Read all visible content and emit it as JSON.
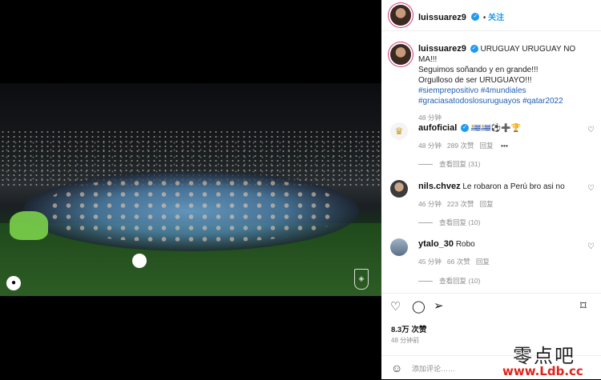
{
  "post": {
    "username": "luissuarez9",
    "follow_label": "关注",
    "caption_line1": "URUGUAY URUGUAY NO MA!!!",
    "caption_line2": "Seguimos soñando y en grande!!!",
    "caption_line3": "Orgulloso de ser URUGUAYO!!!",
    "hashtags_line1": "#siemprepositivo #4mundiales",
    "hashtags_line2": "#graciasatodoslosuruguayos #qatar2022",
    "caption_time": "48 分钟"
  },
  "comments": [
    {
      "user": "aufoficial",
      "verified": true,
      "text": "🇺🇾🇺🇾⚽➕🏆",
      "time": "48 分钟",
      "likes": "289 次赞",
      "reply": "回复",
      "more": "•••",
      "view_replies": "查看回复 (31)"
    },
    {
      "user": "nils.chvez",
      "verified": false,
      "text": "Le robaron a Perú bro asi no",
      "time": "46 分钟",
      "likes": "223 次赞",
      "reply": "回复",
      "view_replies": "查看回复 (10)"
    },
    {
      "user": "ytalo_30",
      "verified": false,
      "text": "Robo",
      "time": "45 分钟",
      "likes": "66 次赞",
      "reply": "回复",
      "view_replies": "查看回复 (10)"
    }
  ],
  "footer": {
    "likes": "8.3万 次赞",
    "posted_ago": "48 分钟前",
    "add_comment_placeholder": "添加评论……"
  },
  "watermark": {
    "line1": "零点吧",
    "line2": "www.Ldb.cc"
  },
  "icons": {
    "heart": "heart-icon",
    "comment": "comment-icon",
    "share": "share-icon",
    "save": "bookmark-icon"
  }
}
